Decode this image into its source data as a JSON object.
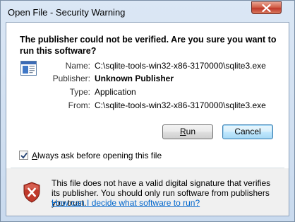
{
  "window": {
    "title": "Open File - Security Warning"
  },
  "dialog": {
    "heading": "The publisher could not be verified.  Are you sure you want to run this software?",
    "fields": [
      {
        "label": "Name:",
        "value": "C:\\sqlite-tools-win32-x86-3170000\\sqlite3.exe",
        "bold": false
      },
      {
        "label": "Publisher:",
        "value": "Unknown Publisher",
        "bold": true
      },
      {
        "label": "Type:",
        "value": "Application",
        "bold": false
      },
      {
        "label": "From:",
        "value": "C:\\sqlite-tools-win32-x86-3170000\\sqlite3.exe",
        "bold": false
      }
    ],
    "run_button": {
      "before": "",
      "accel": "R",
      "after": "un"
    },
    "cancel_label": "Cancel",
    "checkbox": {
      "checked": true,
      "accel": "A",
      "rest": "lways ask before opening this file"
    },
    "warning_text": "This file does not have a valid digital signature that verifies its publisher.  You should only run software from publishers you trust.",
    "help_link": "How can I decide what software to run?"
  },
  "icons": {
    "close": "close-icon",
    "file": "application-file-icon",
    "warning": "red-shield-x-icon",
    "check": "checkmark-icon"
  },
  "colors": {
    "link": "#0066cc",
    "shield": "#c0392b"
  }
}
